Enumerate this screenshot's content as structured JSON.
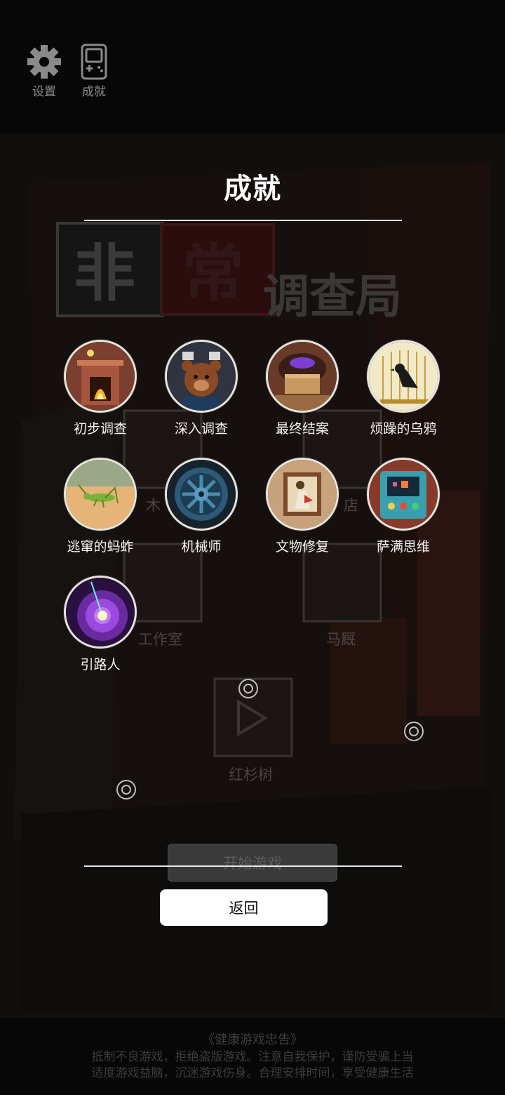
{
  "top_menu": {
    "settings_label": "设置",
    "achievements_label": "成就"
  },
  "background": {
    "game_logo": "非常调查局",
    "levels": [
      {
        "label": "木"
      },
      {
        "label": "店"
      },
      {
        "label": "工作室"
      },
      {
        "label": "马厩"
      },
      {
        "label": "红杉树"
      }
    ],
    "start_button": "开始游戏"
  },
  "dialog": {
    "title": "成就",
    "achievements": [
      {
        "name": "初步调查",
        "icon": "fireplace-icon"
      },
      {
        "name": "深入调查",
        "icon": "bear-mask-icon"
      },
      {
        "name": "最终结案",
        "icon": "treasure-chest-icon"
      },
      {
        "name": "烦躁的乌鸦",
        "icon": "caged-crow-icon"
      },
      {
        "name": "逃窜的蚂蚱",
        "icon": "grasshopper-icon"
      },
      {
        "name": "机械师",
        "icon": "gear-wheel-icon"
      },
      {
        "name": "文物修复",
        "icon": "painting-icon"
      },
      {
        "name": "萨满思维",
        "icon": "control-panel-icon"
      },
      {
        "name": "引路人",
        "icon": "purple-vortex-icon"
      }
    ],
    "back_button": "返回"
  },
  "health_notice": {
    "title": "《健康游戏忠告》",
    "line1": "抵制不良游戏，拒绝盗版游戏。注意自我保护，谨防受骗上当",
    "line2": "适度游戏益脑，沉迷游戏伤身。合理安排时间，享受健康生活"
  }
}
